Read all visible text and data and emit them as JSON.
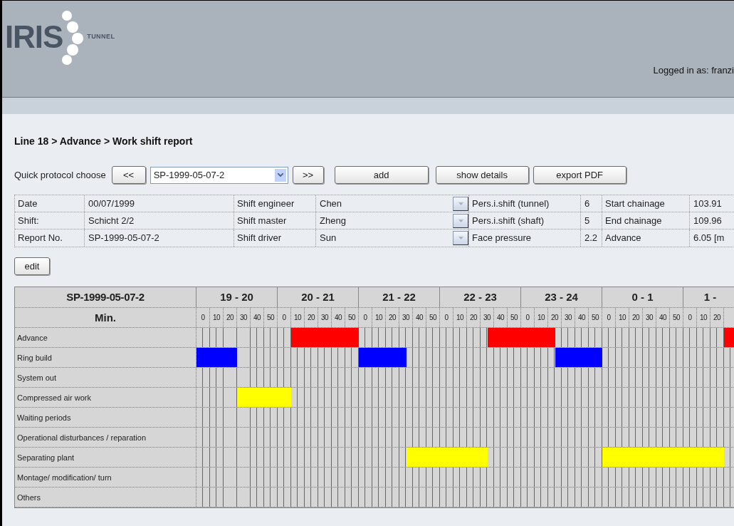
{
  "header": {
    "logo_main": "IRIS",
    "logo_sub": "TUNNEL",
    "logged_in": "Logged in as: franzi"
  },
  "breadcrumb": "Line 18 > Advance > Work shift report",
  "toolbar": {
    "label": "Quick protocol choose",
    "prev": "<<",
    "select_value": "SP-1999-05-07-2",
    "next": ">>",
    "buttons": [
      "add",
      "show details",
      "export PDF"
    ]
  },
  "info_rows": [
    {
      "cells": [
        {
          "label": "Date",
          "value": "00/07/1999"
        },
        {
          "label": "Shift engineer",
          "value": "Chen",
          "dropdown": true
        },
        {
          "label": "Pers.i.shift (tunnel)",
          "value": "6"
        },
        {
          "label": "Start chainage",
          "value": "103.91"
        }
      ]
    },
    {
      "cells": [
        {
          "label": "Shift:",
          "value": "Schicht 2/2"
        },
        {
          "label": "Shift master",
          "value": "Zheng",
          "dropdown": true
        },
        {
          "label": "Pers.i.shift (shaft)",
          "value": "5"
        },
        {
          "label": "End chainage",
          "value": "109.96"
        }
      ]
    },
    {
      "cells": [
        {
          "label": "Report No.",
          "value": "SP-1999-05-07-2"
        },
        {
          "label": "Shift driver",
          "value": "Sun",
          "dropdown": true
        },
        {
          "label": "Face pressure",
          "value": "2.2"
        },
        {
          "label": "Advance",
          "value": "6.05 [m"
        }
      ]
    }
  ],
  "edit_button": "edit",
  "schedule": {
    "title": "SP-1999-05-07-2",
    "minutes_label": "Min.",
    "hours": [
      {
        "label": "19 - 20",
        "minutes": [
          "0",
          "10",
          "20",
          "30",
          "40",
          "50"
        ]
      },
      {
        "label": "20 - 21",
        "minutes": [
          "0",
          "10",
          "20",
          "30",
          "40",
          "50"
        ]
      },
      {
        "label": "21 - 22",
        "minutes": [
          "0",
          "10",
          "20",
          "30",
          "40",
          "50"
        ]
      },
      {
        "label": "22 - 23",
        "minutes": [
          "0",
          "10",
          "20",
          "30",
          "40",
          "50"
        ]
      },
      {
        "label": "23 - 24",
        "minutes": [
          "0",
          "10",
          "20",
          "30",
          "40",
          "50"
        ]
      },
      {
        "label": "0 - 1",
        "minutes": [
          "0",
          "10",
          "20",
          "30",
          "40",
          "50"
        ]
      },
      {
        "label": "1 -",
        "minutes": [
          "0",
          "10",
          "20"
        ]
      }
    ],
    "rows": [
      {
        "name": "Advance",
        "slots": [
          {
            "kind": "empty"
          },
          {
            "kind": "empty"
          },
          {
            "kind": "empty"
          },
          {
            "kind": "empty"
          },
          {
            "kind": "empty"
          },
          {
            "kind": "empty"
          },
          {
            "kind": "empty"
          },
          {
            "kind": "empty"
          },
          {
            "kind": "empty"
          },
          {
            "kind": "empty"
          },
          {
            "kind": "empty"
          },
          {
            "kind": "empty"
          },
          {
            "kind": "empty"
          },
          {
            "kind": "empty"
          },
          {
            "kind": "block",
            "color": "#ff0000"
          },
          {
            "kind": "block",
            "color": "#ff0000"
          },
          {
            "kind": "block",
            "color": "#ff0000"
          },
          {
            "kind": "block",
            "color": "#ff0000"
          },
          {
            "kind": "block",
            "color": "#ff0000"
          },
          {
            "kind": "block",
            "color": "#ff0000"
          },
          {
            "kind": "block",
            "color": "#ff0000"
          },
          {
            "kind": "block",
            "color": "#ff0000"
          },
          {
            "kind": "block",
            "color": "#ff0000"
          },
          {
            "kind": "block",
            "color": "#ff0000"
          },
          {
            "kind": "empty"
          },
          {
            "kind": "empty"
          },
          {
            "kind": "empty"
          },
          {
            "kind": "empty"
          },
          {
            "kind": "empty"
          },
          {
            "kind": "empty"
          },
          {
            "kind": "empty"
          },
          {
            "kind": "empty"
          },
          {
            "kind": "empty"
          },
          {
            "kind": "empty"
          },
          {
            "kind": "empty"
          },
          {
            "kind": "empty"
          },
          {
            "kind": "empty"
          },
          {
            "kind": "empty"
          },
          {
            "kind": "empty"
          },
          {
            "kind": "empty"
          },
          {
            "kind": "empty"
          },
          {
            "kind": "empty"
          },
          {
            "kind": "empty"
          },
          {
            "kind": "block",
            "color": "#ff0000"
          },
          {
            "kind": "block",
            "color": "#ff0000"
          },
          {
            "kind": "block",
            "color": "#ff0000"
          },
          {
            "kind": "block",
            "color": "#ff0000"
          },
          {
            "kind": "block",
            "color": "#ff0000"
          },
          {
            "kind": "block",
            "color": "#ff0000"
          },
          {
            "kind": "block",
            "color": "#ff0000"
          },
          {
            "kind": "block",
            "color": "#ff0000"
          },
          {
            "kind": "block",
            "color": "#ff0000"
          },
          {
            "kind": "block",
            "color": "#ff0000"
          },
          {
            "kind": "empty"
          },
          {
            "kind": "empty"
          },
          {
            "kind": "empty"
          },
          {
            "kind": "empty"
          },
          {
            "kind": "empty"
          },
          {
            "kind": "empty"
          },
          {
            "kind": "empty"
          },
          {
            "kind": "empty"
          },
          {
            "kind": "empty"
          },
          {
            "kind": "empty"
          },
          {
            "kind": "empty"
          },
          {
            "kind": "empty"
          },
          {
            "kind": "empty"
          },
          {
            "kind": "empty"
          },
          {
            "kind": "empty"
          },
          {
            "kind": "empty"
          },
          {
            "kind": "empty"
          },
          {
            "kind": "empty"
          },
          {
            "kind": "empty"
          },
          {
            "kind": "empty"
          },
          {
            "kind": "empty"
          },
          {
            "kind": "empty"
          },
          {
            "kind": "empty"
          },
          {
            "kind": "empty"
          },
          {
            "kind": "empty"
          },
          {
            "kind": "block",
            "color": "#ff0000"
          },
          {
            "kind": "block",
            "color": "#ff0000"
          }
        ]
      },
      {
        "name": "Ring build",
        "slots": [
          {
            "kind": "block",
            "color": "#0000ff"
          },
          {
            "kind": "block",
            "color": "#0000ff"
          },
          {
            "kind": "block",
            "color": "#0000ff"
          },
          {
            "kind": "block",
            "color": "#0000ff"
          },
          {
            "kind": "block",
            "color": "#0000ff"
          },
          {
            "kind": "block",
            "color": "#0000ff"
          },
          {
            "kind": "empty"
          },
          {
            "kind": "empty"
          },
          {
            "kind": "empty"
          },
          {
            "kind": "empty"
          },
          {
            "kind": "empty"
          },
          {
            "kind": "empty"
          },
          {
            "kind": "empty"
          },
          {
            "kind": "empty"
          },
          {
            "kind": "empty"
          },
          {
            "kind": "empty"
          },
          {
            "kind": "empty"
          },
          {
            "kind": "empty"
          },
          {
            "kind": "empty"
          },
          {
            "kind": "empty"
          },
          {
            "kind": "empty"
          },
          {
            "kind": "empty"
          },
          {
            "kind": "empty"
          },
          {
            "kind": "empty"
          },
          {
            "kind": "block",
            "color": "#0000ff"
          },
          {
            "kind": "block",
            "color": "#0000ff"
          },
          {
            "kind": "block",
            "color": "#0000ff"
          },
          {
            "kind": "block",
            "color": "#0000ff"
          },
          {
            "kind": "block",
            "color": "#0000ff"
          },
          {
            "kind": "block",
            "color": "#0000ff"
          },
          {
            "kind": "block",
            "color": "#0000ff"
          },
          {
            "kind": "empty"
          },
          {
            "kind": "empty"
          },
          {
            "kind": "empty"
          },
          {
            "kind": "empty"
          },
          {
            "kind": "empty"
          },
          {
            "kind": "empty"
          },
          {
            "kind": "empty"
          },
          {
            "kind": "empty"
          },
          {
            "kind": "empty"
          },
          {
            "kind": "empty"
          },
          {
            "kind": "empty"
          },
          {
            "kind": "empty"
          },
          {
            "kind": "empty"
          },
          {
            "kind": "empty"
          },
          {
            "kind": "empty"
          },
          {
            "kind": "empty"
          },
          {
            "kind": "empty"
          },
          {
            "kind": "empty"
          },
          {
            "kind": "empty"
          },
          {
            "kind": "empty"
          },
          {
            "kind": "empty"
          },
          {
            "kind": "empty"
          },
          {
            "kind": "block",
            "color": "#0000ff"
          },
          {
            "kind": "block",
            "color": "#0000ff"
          },
          {
            "kind": "block",
            "color": "#0000ff"
          },
          {
            "kind": "block",
            "color": "#0000ff"
          },
          {
            "kind": "block",
            "color": "#0000ff"
          },
          {
            "kind": "block",
            "color": "#0000ff"
          },
          {
            "kind": "block",
            "color": "#0000ff"
          }
        ]
      },
      {
        "name": "System out"
      },
      {
        "name": "Compressed air work",
        "slots": [
          {
            "kind": "empty"
          },
          {
            "kind": "empty"
          },
          {
            "kind": "empty"
          },
          {
            "kind": "empty"
          },
          {
            "kind": "empty"
          },
          {
            "kind": "empty"
          },
          {
            "kind": "block",
            "color": "#ffff00"
          },
          {
            "kind": "block",
            "color": "#ffff00"
          },
          {
            "kind": "block",
            "color": "#ffff00"
          },
          {
            "kind": "block",
            "color": "#ffff00"
          },
          {
            "kind": "block",
            "color": "#ffff00"
          },
          {
            "kind": "block",
            "color": "#ffff00"
          },
          {
            "kind": "block",
            "color": "#ffff00"
          },
          {
            "kind": "block",
            "color": "#ffff00"
          }
        ]
      },
      {
        "name": "Waiting periods"
      },
      {
        "name": "Operational disturbances / reparation"
      },
      {
        "name": "Separating plant",
        "slots": [
          {
            "kind": "empty"
          },
          {
            "kind": "empty"
          },
          {
            "kind": "empty"
          },
          {
            "kind": "empty"
          },
          {
            "kind": "empty"
          },
          {
            "kind": "empty"
          },
          {
            "kind": "empty"
          },
          {
            "kind": "empty"
          },
          {
            "kind": "empty"
          },
          {
            "kind": "empty"
          },
          {
            "kind": "empty"
          },
          {
            "kind": "empty"
          },
          {
            "kind": "empty"
          },
          {
            "kind": "empty"
          },
          {
            "kind": "empty"
          },
          {
            "kind": "empty"
          },
          {
            "kind": "empty"
          },
          {
            "kind": "empty"
          },
          {
            "kind": "empty"
          },
          {
            "kind": "empty"
          },
          {
            "kind": "empty"
          },
          {
            "kind": "empty"
          },
          {
            "kind": "empty"
          },
          {
            "kind": "empty"
          },
          {
            "kind": "empty"
          },
          {
            "kind": "empty"
          },
          {
            "kind": "empty"
          },
          {
            "kind": "empty"
          },
          {
            "kind": "empty"
          },
          {
            "kind": "empty"
          },
          {
            "kind": "empty"
          },
          {
            "kind": "block",
            "color": "#ffff00"
          },
          {
            "kind": "block",
            "color": "#ffff00"
          },
          {
            "kind": "block",
            "color": "#ffff00"
          },
          {
            "kind": "block",
            "color": "#ffff00"
          },
          {
            "kind": "block",
            "color": "#ffff00"
          },
          {
            "kind": "block",
            "color": "#ffff00"
          },
          {
            "kind": "block",
            "color": "#ffff00"
          },
          {
            "kind": "block",
            "color": "#ffff00"
          },
          {
            "kind": "block",
            "color": "#ffff00"
          },
          {
            "kind": "block",
            "color": "#ffff00"
          },
          {
            "kind": "block",
            "color": "#ffff00"
          },
          {
            "kind": "block",
            "color": "#ffff00"
          },
          {
            "kind": "empty"
          },
          {
            "kind": "empty"
          },
          {
            "kind": "empty"
          },
          {
            "kind": "empty"
          },
          {
            "kind": "empty"
          },
          {
            "kind": "empty"
          },
          {
            "kind": "empty"
          },
          {
            "kind": "empty"
          },
          {
            "kind": "empty"
          },
          {
            "kind": "empty"
          },
          {
            "kind": "empty"
          },
          {
            "kind": "empty"
          },
          {
            "kind": "empty"
          },
          {
            "kind": "empty"
          },
          {
            "kind": "empty"
          },
          {
            "kind": "empty"
          },
          {
            "kind": "empty"
          },
          {
            "kind": "block",
            "color": "#ffff00"
          },
          {
            "kind": "block",
            "color": "#ffff00"
          },
          {
            "kind": "block",
            "color": "#ffff00"
          },
          {
            "kind": "block",
            "color": "#ffff00"
          },
          {
            "kind": "block",
            "color": "#ffff00"
          },
          {
            "kind": "block",
            "color": "#ffff00"
          },
          {
            "kind": "block",
            "color": "#ffff00"
          },
          {
            "kind": "block",
            "color": "#ffff00"
          },
          {
            "kind": "block",
            "color": "#ffff00"
          },
          {
            "kind": "block",
            "color": "#ffff00"
          },
          {
            "kind": "block",
            "color": "#ffff00"
          },
          {
            "kind": "block",
            "color": "#ffff00"
          },
          {
            "kind": "block",
            "color": "#ffff00"
          },
          {
            "kind": "block",
            "color": "#ffff00"
          },
          {
            "kind": "block",
            "color": "#ffff00"
          },
          {
            "kind": "block",
            "color": "#ffff00"
          },
          {
            "kind": "block",
            "color": "#ffff00"
          },
          {
            "kind": "block",
            "color": "#ffff00"
          }
        ]
      },
      {
        "name": "Montage/ modification/ turn"
      },
      {
        "name": "Others"
      }
    ]
  }
}
